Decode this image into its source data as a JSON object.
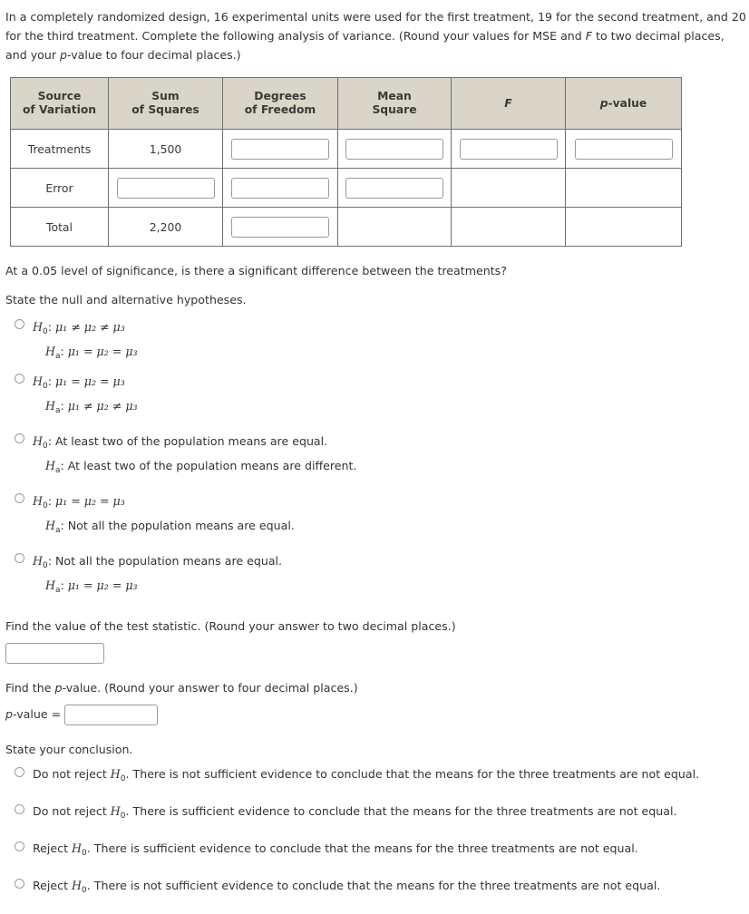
{
  "intro": {
    "part1": "In a completely randomized design, 16 experimental units were used for the first treatment, 19 for the second treatment, and 20 for the third treatment. Complete the following analysis of variance. (Round your values for MSE and ",
    "italic_f": "F",
    "part2": " to two decimal places, and your ",
    "italic_p": "p",
    "part3": "-value to four decimal places.)"
  },
  "table": {
    "headers": [
      {
        "line1": "Source",
        "line2": "of Variation"
      },
      {
        "line1": "Sum",
        "line2": "of Squares"
      },
      {
        "line1": "Degrees",
        "line2": "of Freedom"
      },
      {
        "line1": "Mean",
        "line2": "Square"
      },
      {
        "line1": "F",
        "line2": "",
        "italic": true
      },
      {
        "line1": "p",
        "line2": "-value",
        "italic_prefix": true
      }
    ],
    "rows": [
      {
        "source": "Treatments",
        "sum_of_squares": "1,500",
        "df_input": "",
        "mean_square_input": "",
        "f_input": "",
        "p_input": ""
      },
      {
        "source": "Error",
        "sum_of_squares_input": "",
        "df_input": "",
        "mean_square_input": ""
      },
      {
        "source": "Total",
        "sum_of_squares": "2,200",
        "df_input": ""
      }
    ]
  },
  "significance_question": "At a 0.05 level of significance, is there a significant difference between the treatments?",
  "hypotheses_prompt": "State the null and alternative hypotheses.",
  "hypothesis_options": [
    {
      "null_label": "H",
      "null_sub": "0",
      "null_text": "μ₁ ≠ μ₂ ≠ μ₃",
      "alt_label": "H",
      "alt_sub": "a",
      "alt_text": "μ₁ = μ₂ = μ₃",
      "null_kind": "math",
      "alt_kind": "math",
      "null_rel": "≠",
      "alt_rel": "="
    },
    {
      "null_label": "H",
      "null_sub": "0",
      "null_text": "μ₁ = μ₂ = μ₃",
      "alt_label": "H",
      "alt_sub": "a",
      "alt_text": "μ₁ ≠ μ₂ ≠ μ₃",
      "null_kind": "math",
      "alt_kind": "math",
      "null_rel": "=",
      "alt_rel": "≠"
    },
    {
      "null_label": "H",
      "null_sub": "0",
      "null_text": "At least two of the population means are equal.",
      "alt_label": "H",
      "alt_sub": "a",
      "alt_text": "At least two of the population means are different.",
      "null_kind": "text",
      "alt_kind": "text"
    },
    {
      "null_label": "H",
      "null_sub": "0",
      "null_text": "μ₁ = μ₂ = μ₃",
      "alt_label": "H",
      "alt_sub": "a",
      "alt_text": "Not all the population means are equal.",
      "null_kind": "math",
      "alt_kind": "text",
      "null_rel": "="
    },
    {
      "null_label": "H",
      "null_sub": "0",
      "null_text": "Not all the population means are equal.",
      "alt_label": "H",
      "alt_sub": "a",
      "alt_text": "μ₁ = μ₂ = μ₃",
      "null_kind": "text",
      "alt_kind": "math",
      "alt_rel": "="
    }
  ],
  "test_statistic": {
    "prompt": "Find the value of the test statistic. (Round your answer to two decimal places.)",
    "value": ""
  },
  "p_value": {
    "prompt_part1": "Find the ",
    "prompt_italic": "p",
    "prompt_part2": "-value. (Round your answer to four decimal places.)",
    "label_italic": "p",
    "label_rest": "-value =",
    "value": ""
  },
  "conclusion_prompt": "State your conclusion.",
  "conclusion_options": [
    {
      "action": "Do not reject ",
      "h_label": "H",
      "h_sub": "0",
      "rest": ". There is not sufficient evidence to conclude that the means for the three treatments are not equal."
    },
    {
      "action": "Do not reject ",
      "h_label": "H",
      "h_sub": "0",
      "rest": ". There is sufficient evidence to conclude that the means for the three treatments are not equal."
    },
    {
      "action": "Reject ",
      "h_label": "H",
      "h_sub": "0",
      "rest": ". There is sufficient evidence to conclude that the means for the three treatments are not equal."
    },
    {
      "action": "Reject ",
      "h_label": "H",
      "h_sub": "0",
      "rest": ". There is not sufficient evidence to conclude that the means for the three treatments are not equal."
    }
  ],
  "colors": {
    "header_bg": "#d9d5c9",
    "border": "#6f6f6f",
    "input_border": "#9a9a9a",
    "text": "#333333"
  }
}
